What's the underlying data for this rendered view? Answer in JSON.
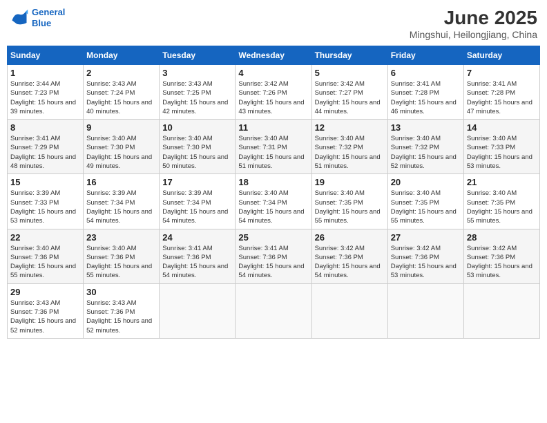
{
  "header": {
    "logo_line1": "General",
    "logo_line2": "Blue",
    "month": "June 2025",
    "location": "Mingshui, Heilongjiang, China"
  },
  "weekdays": [
    "Sunday",
    "Monday",
    "Tuesday",
    "Wednesday",
    "Thursday",
    "Friday",
    "Saturday"
  ],
  "weeks": [
    [
      {
        "day": "1",
        "sunrise": "3:44 AM",
        "sunset": "7:23 PM",
        "daylight": "15 hours and 39 minutes."
      },
      {
        "day": "2",
        "sunrise": "3:43 AM",
        "sunset": "7:24 PM",
        "daylight": "15 hours and 40 minutes."
      },
      {
        "day": "3",
        "sunrise": "3:43 AM",
        "sunset": "7:25 PM",
        "daylight": "15 hours and 42 minutes."
      },
      {
        "day": "4",
        "sunrise": "3:42 AM",
        "sunset": "7:26 PM",
        "daylight": "15 hours and 43 minutes."
      },
      {
        "day": "5",
        "sunrise": "3:42 AM",
        "sunset": "7:27 PM",
        "daylight": "15 hours and 44 minutes."
      },
      {
        "day": "6",
        "sunrise": "3:41 AM",
        "sunset": "7:28 PM",
        "daylight": "15 hours and 46 minutes."
      },
      {
        "day": "7",
        "sunrise": "3:41 AM",
        "sunset": "7:28 PM",
        "daylight": "15 hours and 47 minutes."
      }
    ],
    [
      {
        "day": "8",
        "sunrise": "3:41 AM",
        "sunset": "7:29 PM",
        "daylight": "15 hours and 48 minutes."
      },
      {
        "day": "9",
        "sunrise": "3:40 AM",
        "sunset": "7:30 PM",
        "daylight": "15 hours and 49 minutes."
      },
      {
        "day": "10",
        "sunrise": "3:40 AM",
        "sunset": "7:30 PM",
        "daylight": "15 hours and 50 minutes."
      },
      {
        "day": "11",
        "sunrise": "3:40 AM",
        "sunset": "7:31 PM",
        "daylight": "15 hours and 51 minutes."
      },
      {
        "day": "12",
        "sunrise": "3:40 AM",
        "sunset": "7:32 PM",
        "daylight": "15 hours and 51 minutes."
      },
      {
        "day": "13",
        "sunrise": "3:40 AM",
        "sunset": "7:32 PM",
        "daylight": "15 hours and 52 minutes."
      },
      {
        "day": "14",
        "sunrise": "3:40 AM",
        "sunset": "7:33 PM",
        "daylight": "15 hours and 53 minutes."
      }
    ],
    [
      {
        "day": "15",
        "sunrise": "3:39 AM",
        "sunset": "7:33 PM",
        "daylight": "15 hours and 53 minutes."
      },
      {
        "day": "16",
        "sunrise": "3:39 AM",
        "sunset": "7:34 PM",
        "daylight": "15 hours and 54 minutes."
      },
      {
        "day": "17",
        "sunrise": "3:39 AM",
        "sunset": "7:34 PM",
        "daylight": "15 hours and 54 minutes."
      },
      {
        "day": "18",
        "sunrise": "3:40 AM",
        "sunset": "7:34 PM",
        "daylight": "15 hours and 54 minutes."
      },
      {
        "day": "19",
        "sunrise": "3:40 AM",
        "sunset": "7:35 PM",
        "daylight": "15 hours and 55 minutes."
      },
      {
        "day": "20",
        "sunrise": "3:40 AM",
        "sunset": "7:35 PM",
        "daylight": "15 hours and 55 minutes."
      },
      {
        "day": "21",
        "sunrise": "3:40 AM",
        "sunset": "7:35 PM",
        "daylight": "15 hours and 55 minutes."
      }
    ],
    [
      {
        "day": "22",
        "sunrise": "3:40 AM",
        "sunset": "7:36 PM",
        "daylight": "15 hours and 55 minutes."
      },
      {
        "day": "23",
        "sunrise": "3:40 AM",
        "sunset": "7:36 PM",
        "daylight": "15 hours and 55 minutes."
      },
      {
        "day": "24",
        "sunrise": "3:41 AM",
        "sunset": "7:36 PM",
        "daylight": "15 hours and 54 minutes."
      },
      {
        "day": "25",
        "sunrise": "3:41 AM",
        "sunset": "7:36 PM",
        "daylight": "15 hours and 54 minutes."
      },
      {
        "day": "26",
        "sunrise": "3:42 AM",
        "sunset": "7:36 PM",
        "daylight": "15 hours and 54 minutes."
      },
      {
        "day": "27",
        "sunrise": "3:42 AM",
        "sunset": "7:36 PM",
        "daylight": "15 hours and 53 minutes."
      },
      {
        "day": "28",
        "sunrise": "3:42 AM",
        "sunset": "7:36 PM",
        "daylight": "15 hours and 53 minutes."
      }
    ],
    [
      {
        "day": "29",
        "sunrise": "3:43 AM",
        "sunset": "7:36 PM",
        "daylight": "15 hours and 52 minutes."
      },
      {
        "day": "30",
        "sunrise": "3:43 AM",
        "sunset": "7:36 PM",
        "daylight": "15 hours and 52 minutes."
      },
      null,
      null,
      null,
      null,
      null
    ]
  ]
}
